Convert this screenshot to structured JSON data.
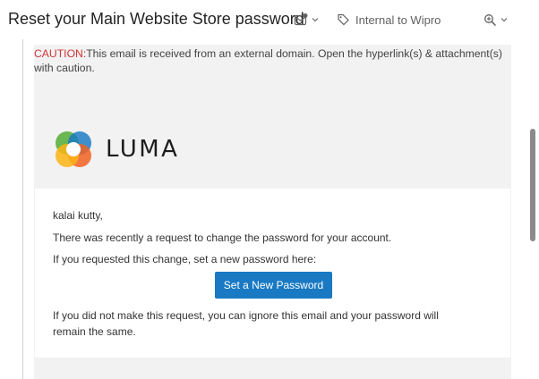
{
  "header": {
    "subject": "Reset your Main Website Store password",
    "sensitivity_label": "Internal to Wipro"
  },
  "caution": {
    "prefix": "CAUTION:",
    "text": "This email is received from an external domain. Open the hyperlink(s) & attachment(s) with caution."
  },
  "brand": {
    "name": "LUMA",
    "logo_colors": [
      "#5fb245",
      "#1979c3",
      "#f26322",
      "#fcb415"
    ]
  },
  "body": {
    "greeting": "kalai kutty,",
    "line1": "There was recently a request to change the password for your account.",
    "line2": "If you requested this change, set a new password here:",
    "button_label": "Set a New Password",
    "line3": "If you did not make this request, you can ignore this email and your password will remain the same."
  },
  "colors": {
    "button": "#1979c3",
    "caution": "#d13438"
  }
}
